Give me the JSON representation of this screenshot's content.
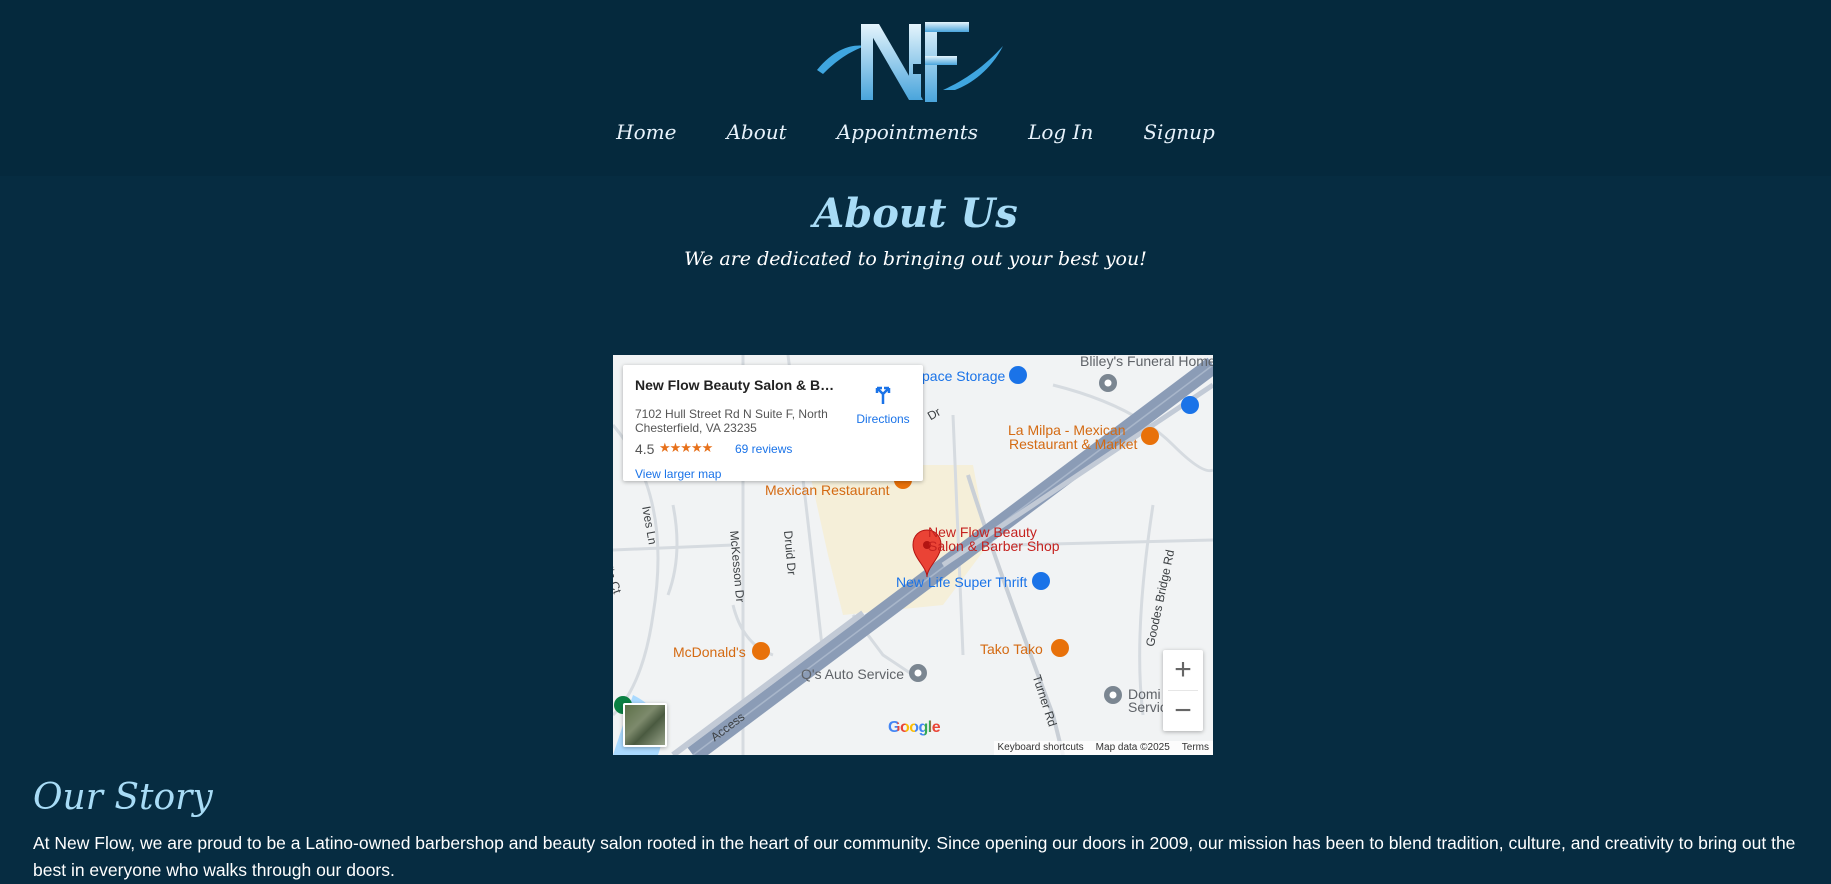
{
  "nav": {
    "items": [
      "Home",
      "About",
      "Appointments",
      "Log In",
      "Signup"
    ]
  },
  "hero": {
    "title": "About Us",
    "subtitle": "We are dedicated to bringing out your best you!"
  },
  "map": {
    "card": {
      "name": "New Flow Beauty Salon & Bar...",
      "address": "7102 Hull Street Rd N Suite F, North Chesterfield, VA 23235",
      "rating": "4.5",
      "stars": "★★★★★",
      "reviews": "69 reviews",
      "larger_map": "View larger map",
      "directions": "Directions"
    },
    "labels": {
      "space_storage": "pace Storage",
      "funeral": "Bliley's Funeral Home",
      "la_milpa_1": "La Milpa - Mexican",
      "la_milpa_2": "Restaurant & Market",
      "mexican_restaurant": "Mexican Restaurant",
      "new_flow_1": "New Flow Beauty",
      "new_flow_2": "Salon & Barber Shop",
      "new_life": "New Life Super Thrift",
      "mcdonalds": "McDonald's",
      "tako": "Tako Tako",
      "qs_auto": "Q's Auto Service",
      "domi_1": "Domi",
      "domi_2": "Servic",
      "road_ives": "Ives Ln",
      "road_mckesson": "McKesson Dr",
      "road_druid": "Druid Dr",
      "road_turner": "Turner Rd",
      "road_goodes": "Goodes Bridge Rd",
      "road_access": "Access",
      "road_dr": "Dr",
      "road_ct": "lin Ct"
    },
    "google": "Google",
    "attribution": [
      "Keyboard shortcuts",
      "Map data ©2025",
      "Terms"
    ],
    "zoom_in": "+",
    "zoom_out": "−"
  },
  "story": {
    "title": "Our Story",
    "text": "At New Flow, we are proud to be a Latino-owned barbershop and beauty salon rooted in the heart of our community. Since opening our doors in 2009, our mission has been to blend tradition, culture, and creativity to bring out the best in everyone who walks through our doors."
  },
  "colors": {
    "background": "#062c41",
    "accent": "#a8dcf6"
  }
}
